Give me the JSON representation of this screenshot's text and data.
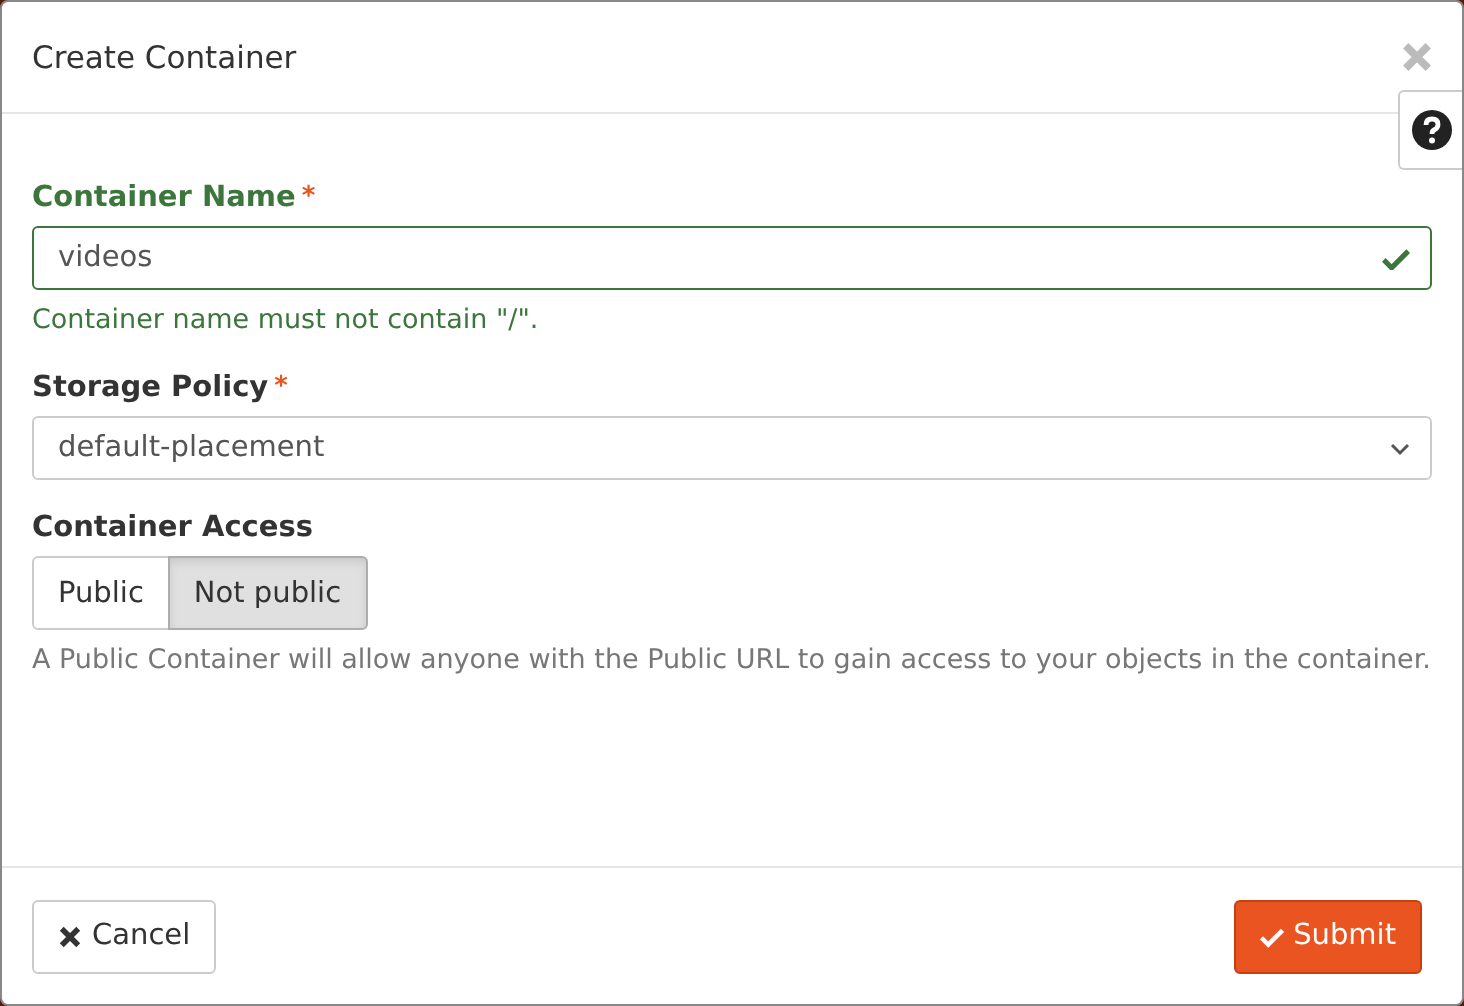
{
  "window": {
    "title": "Create Container"
  },
  "name_field": {
    "label": "Container Name",
    "required_mark": "*",
    "value": "videos",
    "valid": true,
    "help": "Container name must not contain \"/\"."
  },
  "policy_field": {
    "label": "Storage Policy",
    "required_mark": "*",
    "value": "default-placement"
  },
  "access": {
    "label": "Container Access",
    "options": [
      {
        "label": "Public",
        "selected": false
      },
      {
        "label": "Not public",
        "selected": true
      }
    ],
    "help": "A Public Container will allow anyone with the Public URL to gain access to your objects in the container."
  },
  "buttons": [
    {
      "kind": "cancel",
      "label": "Cancel"
    },
    {
      "kind": "submit",
      "label": "Submit"
    }
  ]
}
